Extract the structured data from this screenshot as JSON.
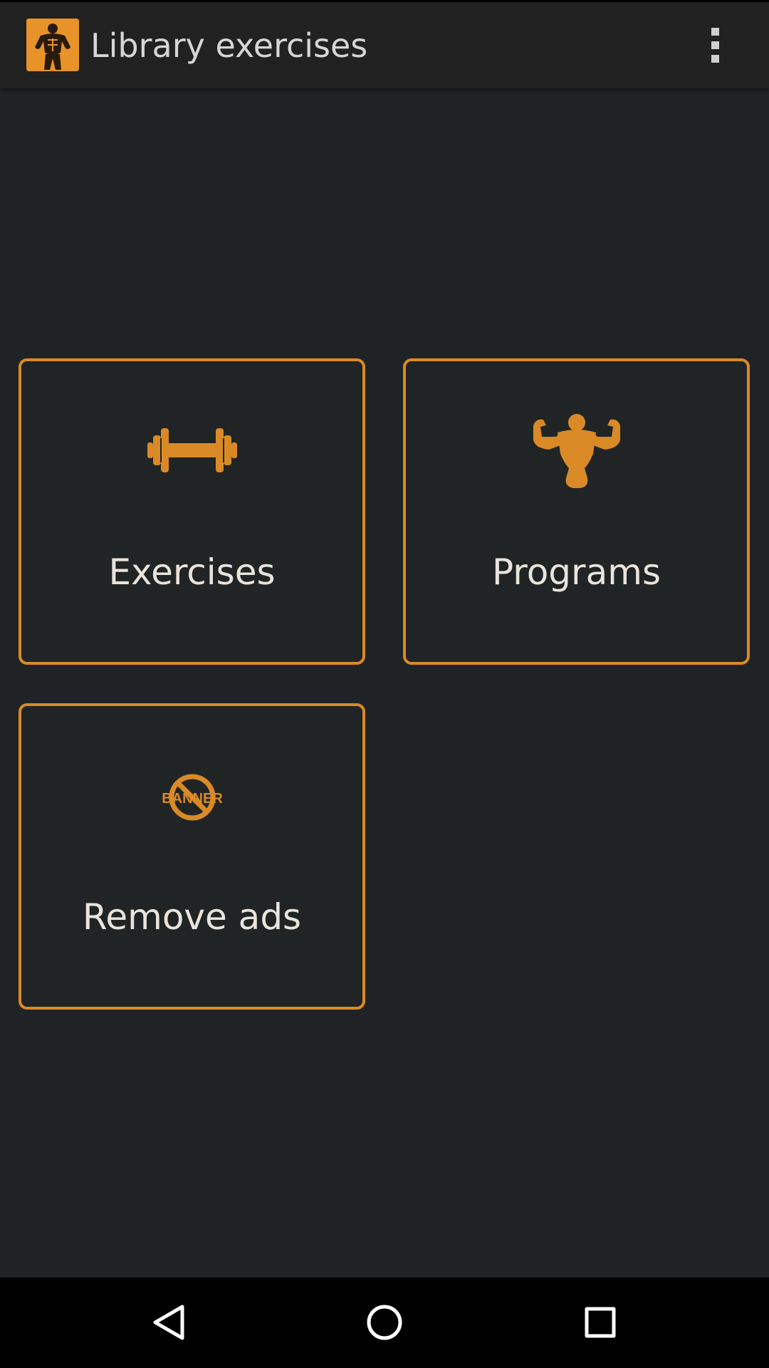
{
  "app_bar": {
    "title": "Library exercises",
    "logo_icon": "bodybuilder-logo-icon",
    "menu_icon": "overflow-menu-icon"
  },
  "tiles": [
    {
      "label": "Exercises",
      "icon": "dumbbell-icon"
    },
    {
      "label": "Programs",
      "icon": "flexing-bodybuilder-icon"
    },
    {
      "label": "Remove ads",
      "icon": "no-banner-icon",
      "icon_text": "BANNER"
    }
  ],
  "nav_bar": {
    "back_icon": "back-triangle-icon",
    "home_icon": "home-circle-icon",
    "recents_icon": "recents-square-icon"
  },
  "colors": {
    "accent": "#d98a27",
    "background": "#202325",
    "app_bar": "#212121",
    "label_text": "#e9e4dc"
  }
}
